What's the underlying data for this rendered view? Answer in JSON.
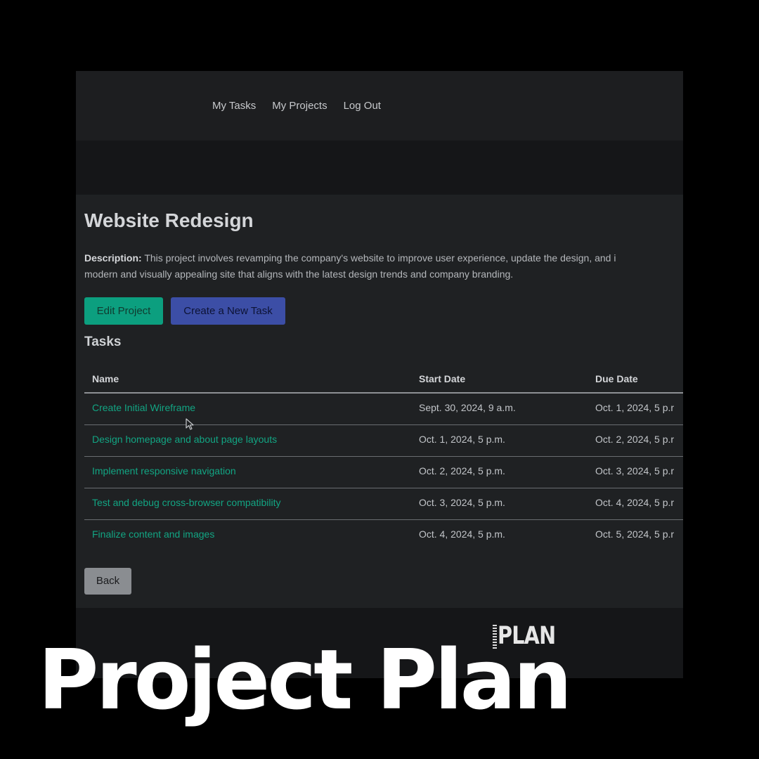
{
  "nav": {
    "links": [
      "My Tasks",
      "My Projects",
      "Log Out"
    ]
  },
  "project": {
    "title": "Website Redesign",
    "description_label": "Description:",
    "description_line1": " This project involves revamping the company's website to improve user experience, update the design, and i",
    "description_line2": "modern and visually appealing site that aligns with the latest design trends and company branding."
  },
  "buttons": {
    "edit": "Edit Project",
    "new_task": "Create a New Task",
    "back": "Back"
  },
  "tasks": {
    "heading": "Tasks",
    "columns": [
      "Name",
      "Start Date",
      "Due Date"
    ],
    "rows": [
      {
        "name": "Create Initial Wireframe",
        "start": "Sept. 30, 2024, 9 a.m.",
        "due": "Oct. 1, 2024, 5 p.r"
      },
      {
        "name": "Design homepage and about page layouts",
        "start": "Oct. 1, 2024, 5 p.m.",
        "due": "Oct. 2, 2024, 5 p.r"
      },
      {
        "name": "Implement responsive navigation",
        "start": "Oct. 2, 2024, 5 p.m.",
        "due": "Oct. 3, 2024, 5 p.r"
      },
      {
        "name": "Test and debug cross-browser compatibility",
        "start": "Oct. 3, 2024, 5 p.m.",
        "due": "Oct. 4, 2024, 5 p.r"
      },
      {
        "name": "Finalize content and images",
        "start": "Oct. 4, 2024, 5 p.m.",
        "due": "Oct. 5, 2024, 5 p.r"
      }
    ]
  },
  "footer": {
    "logo_text": "PLAN"
  },
  "overlay": {
    "title": "Project Plan"
  },
  "colors": {
    "accent_green": "#0c9f7f",
    "accent_blue": "#3c4ea6",
    "link_green": "#12a583"
  },
  "icons": [
    "mouse-cursor-icon"
  ]
}
